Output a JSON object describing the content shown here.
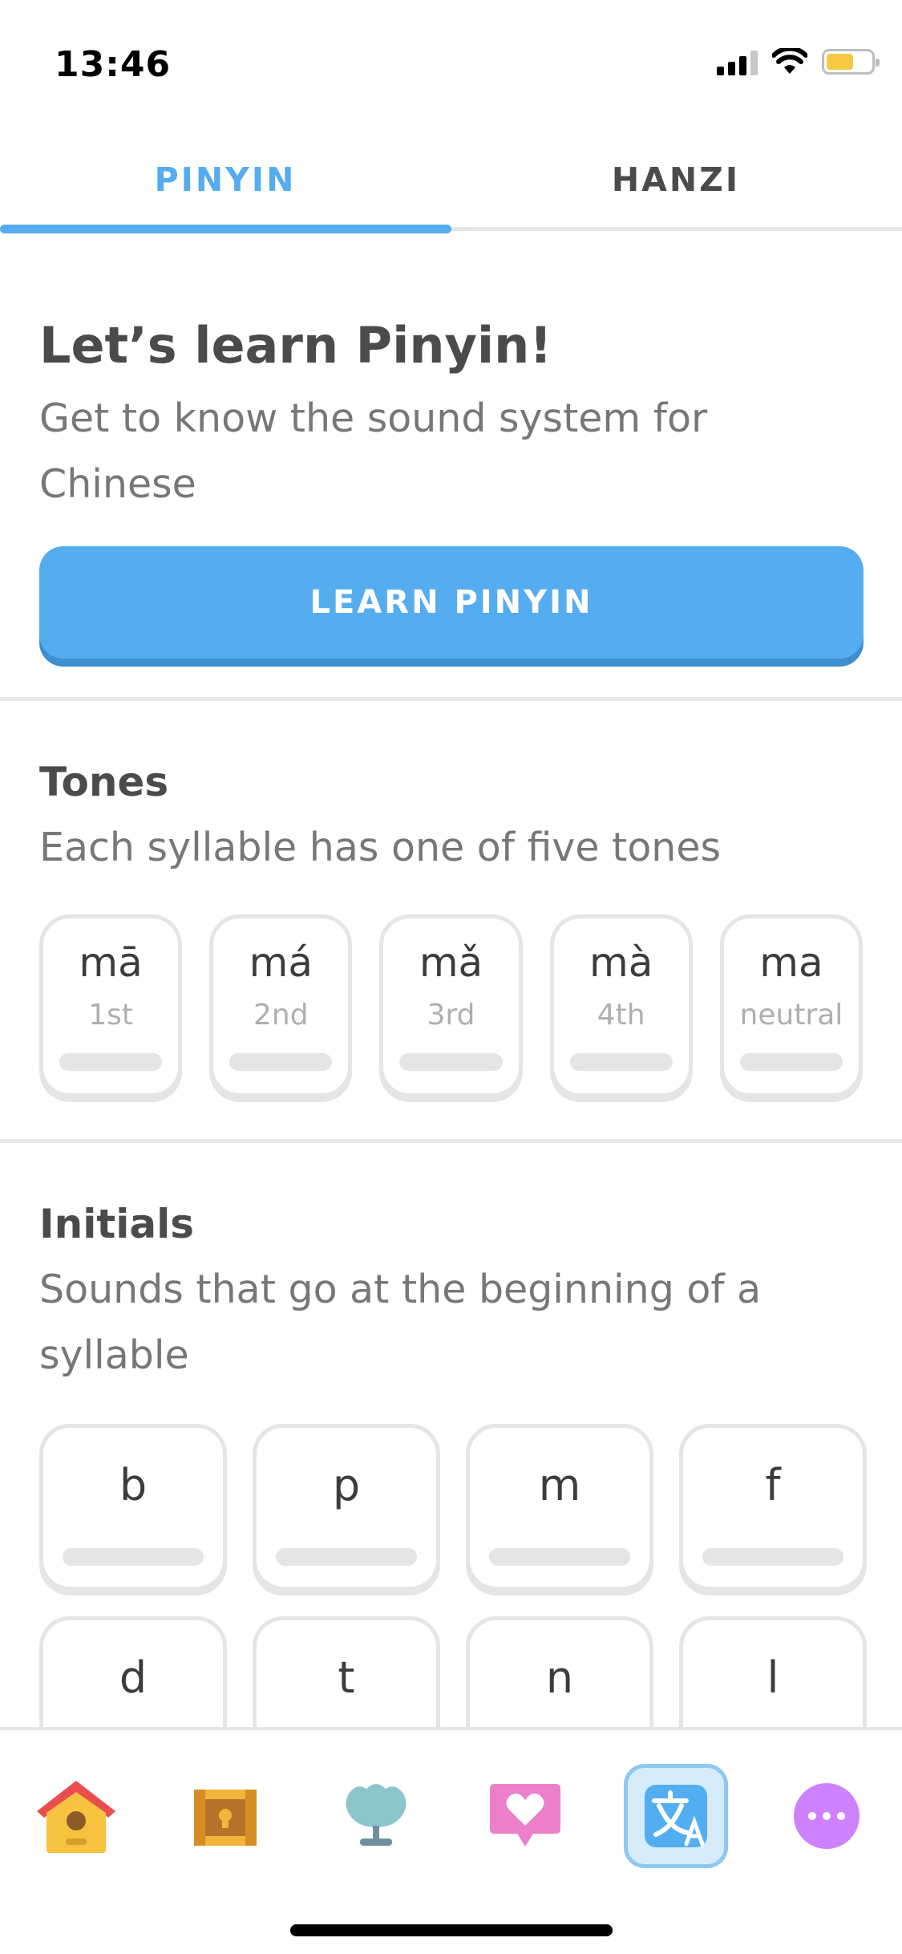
{
  "status_bar": {
    "time": "13:46"
  },
  "tabs": [
    {
      "label": "PINYIN",
      "active": true
    },
    {
      "label": "HANZI",
      "active": false
    }
  ],
  "intro": {
    "title": "Let’s learn Pinyin!",
    "subtitle_line1": "Get to know the sound system for",
    "subtitle_line2": "Chinese",
    "button_label": "LEARN PINYIN"
  },
  "tones": {
    "title": "Tones",
    "subtitle": "Each syllable has one of five tones",
    "items": [
      {
        "char": "mā",
        "label": "1st"
      },
      {
        "char": "má",
        "label": "2nd"
      },
      {
        "char": "mǎ",
        "label": "3rd"
      },
      {
        "char": "mà",
        "label": "4th"
      },
      {
        "char": "ma",
        "label": "neutral"
      }
    ]
  },
  "initials": {
    "title": "Initials",
    "subtitle_line1": "Sounds that go at the beginning of a",
    "subtitle_line2": "syllable",
    "items": [
      {
        "char": "b"
      },
      {
        "char": "p"
      },
      {
        "char": "m"
      },
      {
        "char": "f"
      },
      {
        "char": "d"
      },
      {
        "char": "t"
      },
      {
        "char": "n"
      },
      {
        "char": "l"
      }
    ]
  },
  "bottom_nav": [
    {
      "icon": "home-icon",
      "active": false
    },
    {
      "icon": "treasure-chest-icon",
      "active": false
    },
    {
      "icon": "leaderboard-trophy-icon",
      "active": false
    },
    {
      "icon": "friends-heart-icon",
      "active": false
    },
    {
      "icon": "characters-translate-icon",
      "active": true
    },
    {
      "icon": "more-icon",
      "active": false
    }
  ],
  "colors": {
    "accent": "#55acee",
    "accent_shadow": "#3d8fcf",
    "text_dark": "#4b4b4b",
    "text_muted": "#777777",
    "border": "#e5e5e5"
  }
}
